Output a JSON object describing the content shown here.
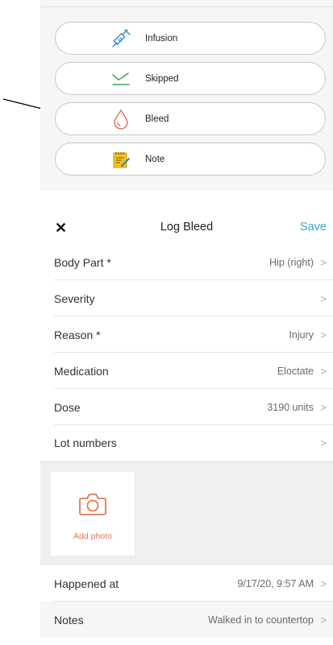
{
  "actions": [
    {
      "label": "Infusion",
      "icon": "syringe-icon"
    },
    {
      "label": "Skipped",
      "icon": "skipped-chart-icon"
    },
    {
      "label": "Bleed",
      "icon": "blood-drop-icon"
    },
    {
      "label": "Note",
      "icon": "notepad-icon"
    }
  ],
  "log": {
    "close_label": "✕",
    "title": "Log Bleed",
    "save_label": "Save",
    "fields": [
      {
        "label": "Body Part *",
        "value": "Hip (right)"
      },
      {
        "label": "Severity",
        "value": ""
      },
      {
        "label": "Reason *",
        "value": "Injury"
      },
      {
        "label": "Medication",
        "value": "Eloctate"
      },
      {
        "label": "Dose",
        "value": "3190 units"
      },
      {
        "label": "Lot numbers",
        "value": ""
      }
    ],
    "add_photo_label": "Add photo",
    "happened_at": {
      "label": "Happened at",
      "value": "9/17/20, 9:57 AM"
    },
    "notes": {
      "label": "Notes",
      "value": "Walked in to countertop"
    },
    "chevron": ">"
  },
  "colors": {
    "accent": "#3aa6c9",
    "photo_orange": "#e07a53",
    "syringe_blue": "#2f8fc9",
    "skipped_green": "#3aa760",
    "drop_red": "#e0734f",
    "note_yellow": "#f0c419"
  }
}
